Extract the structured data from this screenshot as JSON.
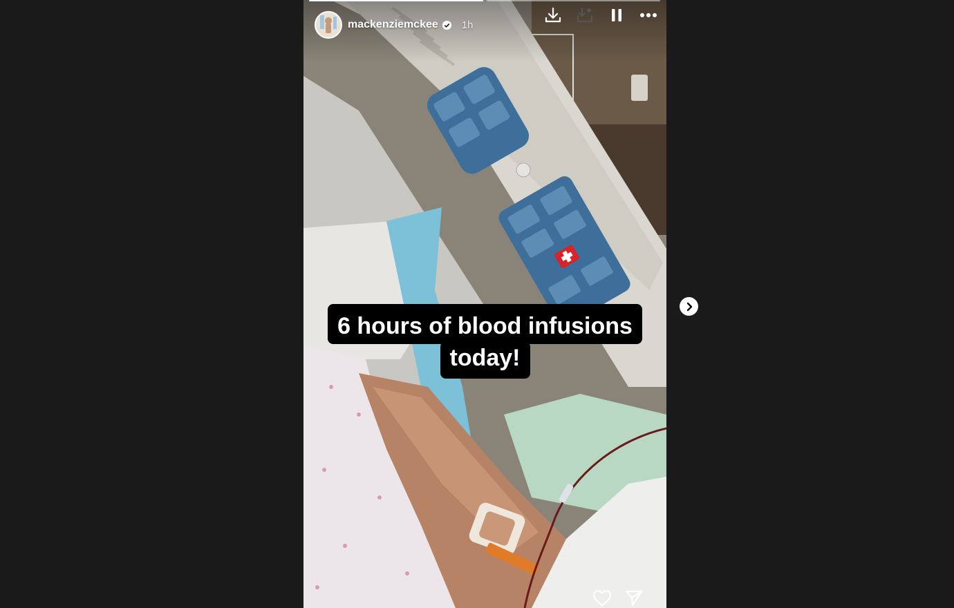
{
  "story": {
    "username": "mackenziemckee",
    "time_ago": "1h",
    "caption_line_1": "6 hours of blood infusions",
    "caption_line_2": "today!",
    "progress": [
      1.0,
      0.0
    ],
    "verified": true
  },
  "icons": {
    "download": "download-icon",
    "save": "save-icon",
    "pause": "pause-icon",
    "more": "more-icon",
    "like": "heart-icon",
    "share": "send-icon",
    "next": "chevron-right-icon"
  },
  "colors": {
    "background": "#1a1a1a",
    "caption_bg": "#000000",
    "caption_text": "#ffffff"
  }
}
